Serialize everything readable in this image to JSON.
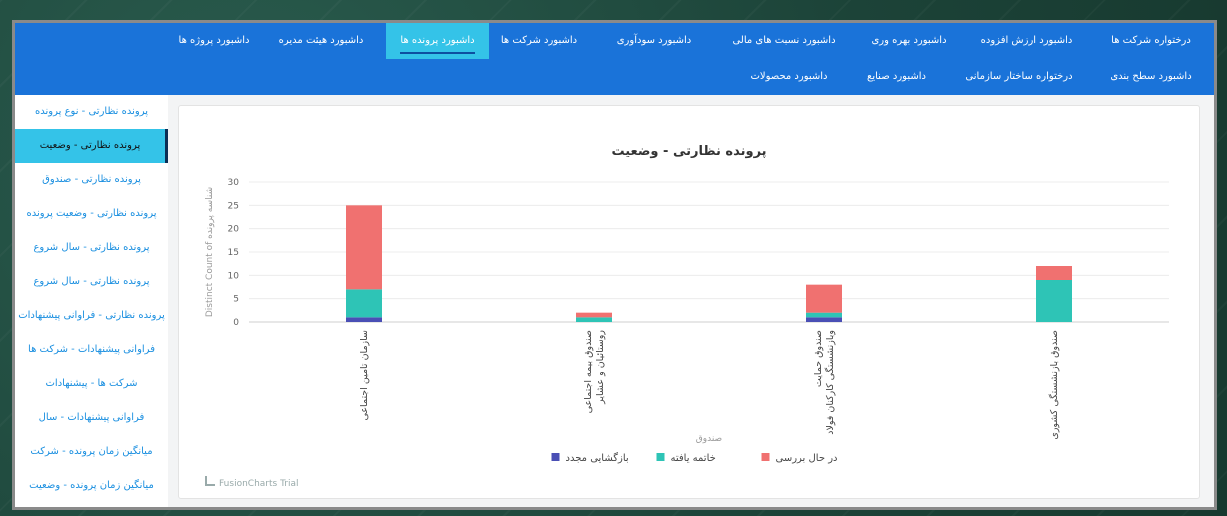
{
  "nav": {
    "row1": [
      {
        "label": "درختواره شرکت ها"
      },
      {
        "label": "داشبورد ارزش افزوده"
      },
      {
        "label": "داشبورد بهره وری"
      },
      {
        "label": "داشبورد نسبت های مالی"
      },
      {
        "label": "داشبورد سودآوری"
      },
      {
        "label": "داشبورد شرکت ها"
      },
      {
        "label": "داشبورد پرونده ها",
        "active": true
      },
      {
        "label": "داشبورد هیئت مدیره"
      },
      {
        "label": "داشبورد پروژه ها"
      }
    ],
    "row2": [
      {
        "label": "داشبورد سطح بندی"
      },
      {
        "label": "درختواره ساختار سازمانی"
      },
      {
        "label": "داشبورد صنایع"
      },
      {
        "label": "داشبورد محصولات"
      }
    ]
  },
  "sidebar": {
    "items": [
      {
        "label": "پرونده نظارتی - نوع پرونده"
      },
      {
        "label": "پرونده نظارتی - وضعیت",
        "active": true
      },
      {
        "label": "پرونده نظارتی - صندوق"
      },
      {
        "label": "پرونده نظارتی - وضعیت پرونده"
      },
      {
        "label": "پرونده نظارتی - سال شروع"
      },
      {
        "label": "پرونده نظارتی - سال شروع"
      },
      {
        "label": "پرونده نظارتی - فراوانی پیشنهادات"
      },
      {
        "label": "فراوانی پیشنهادات - شرکت ها"
      },
      {
        "label": "شرکت ها - پیشنهادات"
      },
      {
        "label": "فراوانی پیشنهادات - سال"
      },
      {
        "label": "میانگین زمان پرونده - شرکت"
      },
      {
        "label": "میانگین زمان پرونده - وضعیت"
      }
    ]
  },
  "brand": "FusionCharts Trial",
  "chart_data": {
    "type": "bar",
    "stacked": true,
    "title": "پرونده نظارتی - وضعیت",
    "xlabel": "صندوق",
    "ylabel": "Distinct Count of شناسه پرونده",
    "ylim": [
      0,
      30
    ],
    "yticks": [
      0,
      5,
      10,
      15,
      20,
      25,
      30
    ],
    "categories": [
      "سازمان تامین اجتماعی",
      "صندوق بیمه اجتماعی روستائیان و عشایر",
      "صندوق حمایت وبازنشستگی کارکنان فولاد",
      "صندوق بازنشستگی کشوری"
    ],
    "category_lines": [
      [
        "سازمان تامین اجتماعی"
      ],
      [
        "صندوق بیمه اجتماعی",
        "روستائیان و عشایر"
      ],
      [
        "صندوق حمایت",
        "وبازنشستگی کارکنان فولاد"
      ],
      [
        "صندوق بازنشستگی کشوری"
      ]
    ],
    "series": [
      {
        "name": "بازگشایی مجدد",
        "color": "#4a4fb5",
        "values": [
          1,
          0,
          1,
          0
        ]
      },
      {
        "name": "خاتمه یافته",
        "color": "#2ec4b6",
        "values": [
          6,
          1,
          1,
          9
        ]
      },
      {
        "name": "در حال بررسی",
        "color": "#f07170",
        "values": [
          18,
          1,
          6,
          3
        ]
      }
    ],
    "legend_position": "bottom",
    "grid": true
  }
}
